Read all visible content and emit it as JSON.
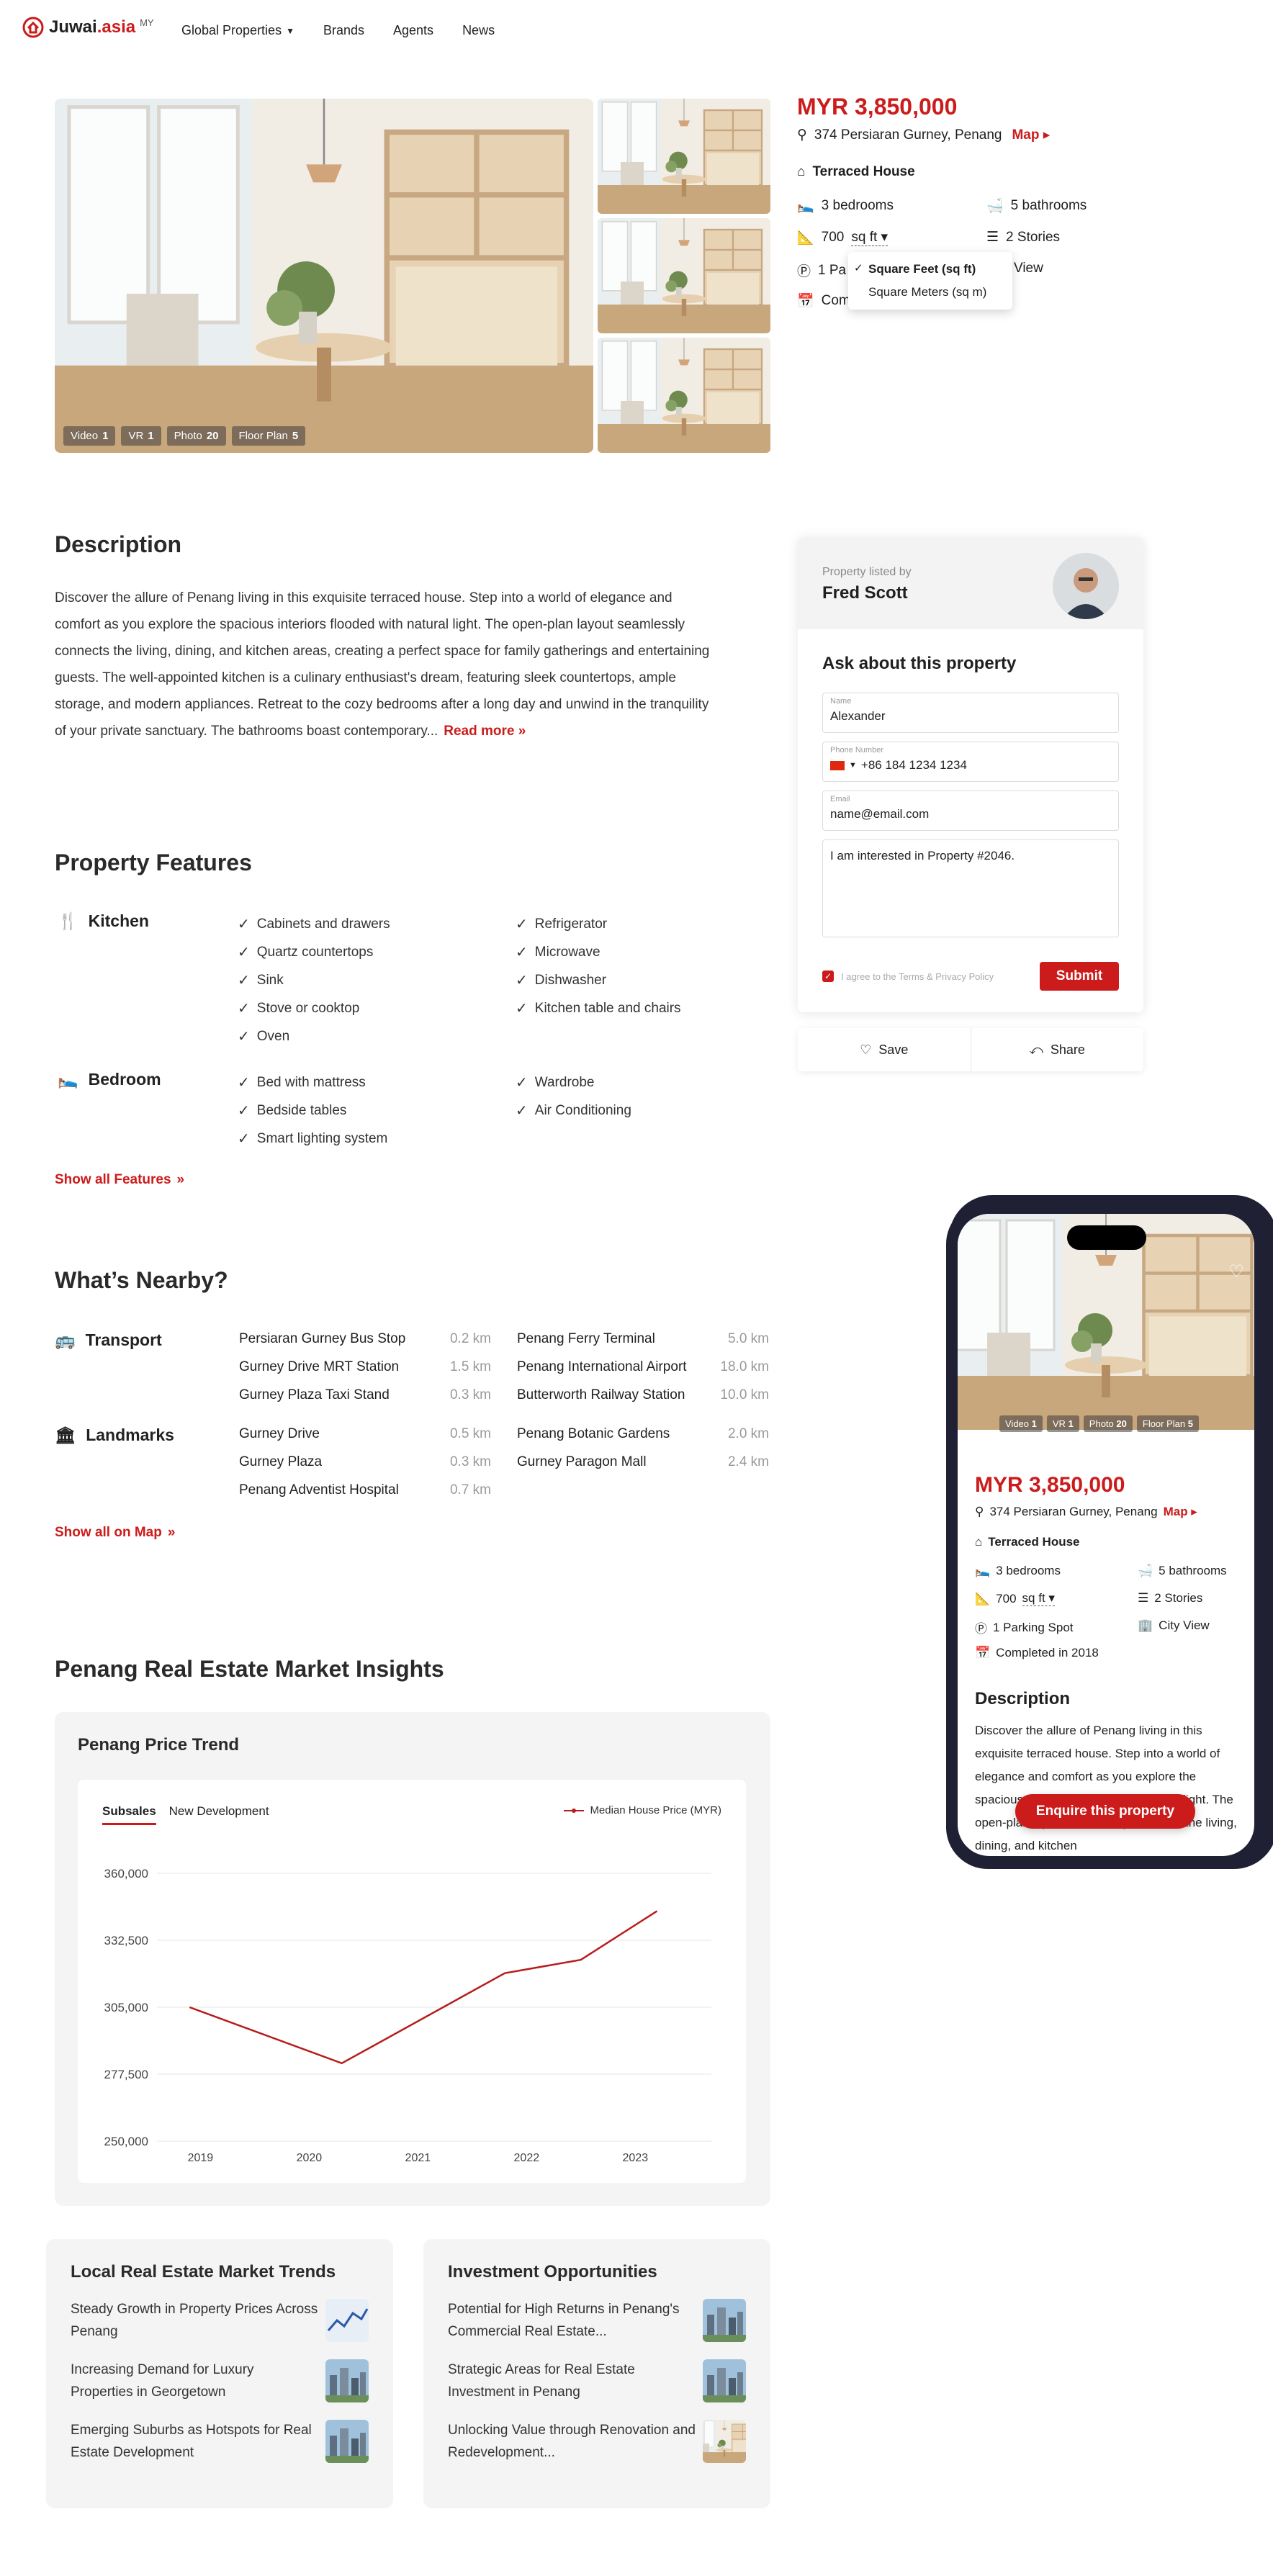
{
  "header": {
    "logo_name": "Juwai",
    "logo_suffix": ".asia",
    "logo_region": "MY",
    "nav": [
      "Global Properties",
      "Brands",
      "Agents",
      "News"
    ]
  },
  "gallery": {
    "badges": [
      {
        "label": "Video",
        "count": "1"
      },
      {
        "label": "VR",
        "count": "1"
      },
      {
        "label": "Photo",
        "count": "20"
      },
      {
        "label": "Floor Plan",
        "count": "5"
      }
    ]
  },
  "listing": {
    "price": "MYR 3,850,000",
    "address": "374  Persiaran Gurney, Penang",
    "map_label": "Map",
    "type": "Terraced House",
    "bedrooms": "3 bedrooms",
    "bathrooms": "5 bathrooms",
    "area_value": "700",
    "area_unit": "sq ft",
    "stories": "2 Stories",
    "parking_partial": "1 Pa",
    "view_partial": "City View",
    "completed_partial": "Com",
    "unit_options": [
      "Square Feet (sq ft)",
      "Square Meters (sq m)"
    ]
  },
  "description": {
    "title": "Description",
    "text": "Discover the allure of Penang living in this exquisite terraced house. Step into a world of elegance and comfort as you explore the spacious interiors flooded with natural light. The open-plan layout seamlessly connects the living, dining, and kitchen areas, creating a perfect space for family gatherings and entertaining guests. The well-appointed kitchen is a culinary enthusiast's dream, featuring sleek countertops, ample storage, and modern appliances. Retreat to the cozy bedrooms after a long day and unwind in the tranquility of your private sanctuary. The bathrooms boast contemporary...",
    "read_more": "Read more"
  },
  "features": {
    "title": "Property Features",
    "kitchen_label": "Kitchen",
    "kitchen_col1": [
      "Cabinets and drawers",
      "Quartz countertops",
      "Sink",
      "Stove or cooktop",
      "Oven"
    ],
    "kitchen_col2": [
      "Refrigerator",
      "Microwave",
      "Dishwasher",
      "Kitchen table and chairs"
    ],
    "bedroom_label": "Bedroom",
    "bedroom_col1": [
      "Bed with mattress",
      "Bedside tables",
      "Smart lighting system"
    ],
    "bedroom_col2": [
      "Wardrobe",
      "Air Conditioning"
    ],
    "show_all": "Show all Features"
  },
  "nearby": {
    "title": "What’s Nearby?",
    "transport_label": "Transport",
    "transport_col1": [
      {
        "name": "Persiaran Gurney Bus Stop",
        "dist": "0.2 km"
      },
      {
        "name": "Gurney Drive MRT Station",
        "dist": "1.5 km"
      },
      {
        "name": "Gurney Plaza Taxi Stand",
        "dist": "0.3 km"
      }
    ],
    "transport_col2": [
      {
        "name": "Penang Ferry Terminal",
        "dist": "5.0 km"
      },
      {
        "name": "Penang International Airport",
        "dist": "18.0 km"
      },
      {
        "name": "Butterworth Railway Station",
        "dist": "10.0 km"
      }
    ],
    "landmarks_label": "Landmarks",
    "landmarks_col1": [
      {
        "name": "Gurney Drive",
        "dist": "0.5 km"
      },
      {
        "name": "Gurney Plaza",
        "dist": "0.3 km"
      },
      {
        "name": "Penang Adventist Hospital",
        "dist": "0.7 km"
      }
    ],
    "landmarks_col2": [
      {
        "name": "Penang Botanic Gardens",
        "dist": "2.0 km"
      },
      {
        "name": "Gurney Paragon Mall",
        "dist": "2.4 km"
      }
    ],
    "show_all": "Show all on Map"
  },
  "agent": {
    "listed_by": "Property listed by",
    "name": "Fred Scott",
    "form_title": "Ask about this property",
    "name_label": "Name",
    "name_value": "Alexander",
    "phone_label": "Phone Number",
    "phone_value": "+86 184 1234 1234",
    "email_label": "Email",
    "email_value": "name@email.com",
    "message": "I am interested in Property #2046.",
    "agree": "I agree to the Terms & Privacy Policy",
    "submit": "Submit",
    "save": "Save",
    "share": "Share"
  },
  "market": {
    "title": "Penang Real Estate Market Insights",
    "chart_title": "Penang Price Trend",
    "tab_active": "Subsales",
    "tab_other": "New Development",
    "legend": "Median House Price (MYR)"
  },
  "chart_data": {
    "type": "line",
    "title": "Penang Price Trend",
    "x": [
      2019,
      2020,
      2021,
      2022,
      2023
    ],
    "x_labels": [
      "2019",
      "2020",
      "2021",
      "2022",
      "2023"
    ],
    "points": [
      [
        2018.9,
        305000
      ],
      [
        2020.3,
        282000
      ],
      [
        2021.8,
        319000
      ],
      [
        2022.5,
        324500
      ],
      [
        2023.2,
        344500
      ]
    ],
    "series": [
      {
        "name": "Median House Price (MYR)",
        "color": "#b71c1c"
      }
    ],
    "y_ticks": [
      "360,000",
      "332,500",
      "305,000",
      "277,500",
      "250,000"
    ],
    "ylim": [
      250000,
      360000
    ],
    "grid": true,
    "legend_position": "top-right"
  },
  "trends": {
    "title": "Local Real Estate Market Trends",
    "items": [
      "Steady Growth in Property Prices Across Penang",
      "Increasing Demand for Luxury Properties in Georgetown",
      "Emerging Suburbs as Hotspots for Real Estate Development"
    ]
  },
  "investment": {
    "title": "Investment Opportunities",
    "items": [
      "Potential for High Returns in Penang's Commercial Real Estate...",
      "Strategic Areas for Real Estate Investment in Penang",
      "Unlocking Value through Renovation and Redevelopment..."
    ]
  },
  "mobile": {
    "price": "MYR 3,850,000",
    "address": "374  Persiaran Gurney, Penang",
    "map_label": "Map",
    "type": "Terraced House",
    "bedrooms": "3 bedrooms",
    "bathrooms": "5 bathrooms",
    "area_value": "700",
    "area_unit": "sq ft",
    "stories": "2 Stories",
    "parking": "1 Parking Spot",
    "view": "City View",
    "completed": "Completed in 2018",
    "desc_title": "Description",
    "desc_text": "Discover the allure of Penang living in this exquisite terraced house. Step into a world of elegance and comfort as you explore the spacious interiors flooded with natural light. The open-plan layout seamlessly connects the living, dining, and kitchen",
    "enquire": "Enquire this property",
    "badges": [
      {
        "label": "Video",
        "count": "1"
      },
      {
        "label": "VR",
        "count": "1"
      },
      {
        "label": "Photo",
        "count": "20"
      },
      {
        "label": "Floor Plan",
        "count": "5"
      }
    ]
  },
  "colors": {
    "accent": "#cc1b1b",
    "phone_frame": "#1f2033",
    "panel": "#f4f4f4"
  }
}
